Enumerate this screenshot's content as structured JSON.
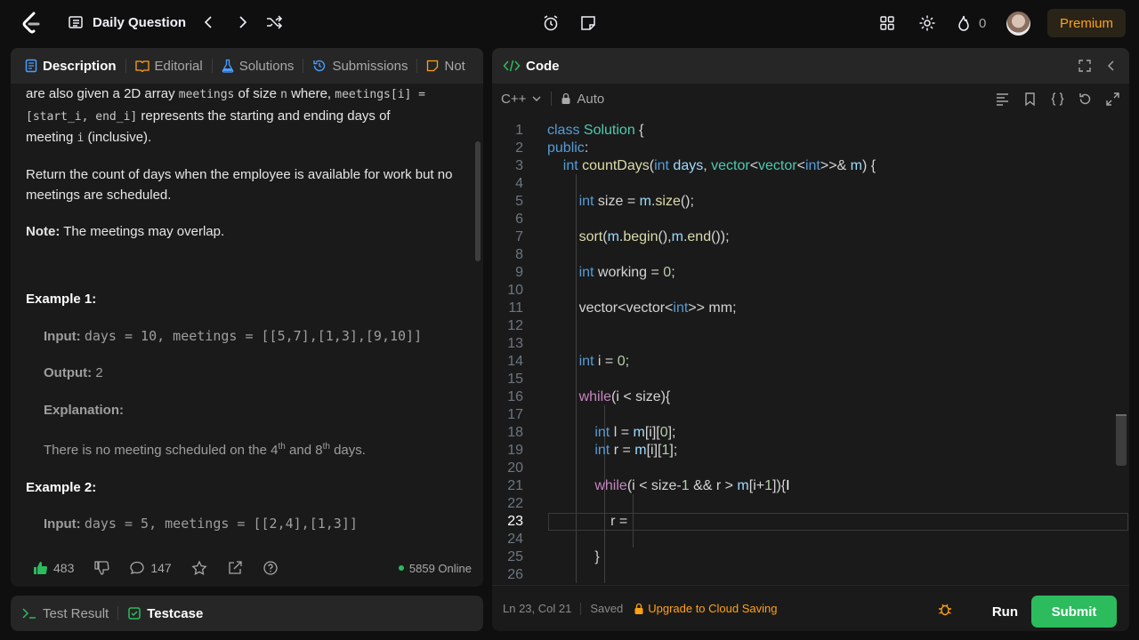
{
  "topbar": {
    "title": "Daily Question",
    "streak_count": "0",
    "premium_label": "Premium"
  },
  "left_panel": {
    "tabs": [
      {
        "label": "Description"
      },
      {
        "label": "Editorial"
      },
      {
        "label": "Solutions"
      },
      {
        "label": "Submissions"
      },
      {
        "label": "Not"
      }
    ],
    "desc": {
      "p1_a": "are also given a 2D array ",
      "p1_code1": "meetings",
      "p1_b": " of size ",
      "p1_code2": "n",
      "p1_c": " where, ",
      "p1_code3": "meetings[i] =",
      "p1_code4": "[start_i, end_i]",
      "p1_d": " represents the starting and ending days of",
      "p1_e": "meeting ",
      "p1_code5": "i",
      "p1_f": " (inclusive).",
      "p2": "Return the count of days when the employee is available for work but no meetings are scheduled.",
      "note_label": "Note:",
      "note_text": " The meetings may overlap.",
      "ex1_title": "Example 1:",
      "ex1_input_label": "Input:",
      "ex1_input": "days = 10, meetings = [[5,7],[1,3],[9,10]]",
      "ex1_output_label": "Output:",
      "ex1_output": "2",
      "ex1_expl_label": "Explanation:",
      "ex1_expl_a": "There is no meeting scheduled on the 4",
      "ex1_expl_sup1": "th",
      "ex1_expl_b": " and 8",
      "ex1_expl_sup2": "th",
      "ex1_expl_c": " days.",
      "ex2_title": "Example 2:",
      "ex2_input_label": "Input:",
      "ex2_input": "days = 5, meetings = [[2,4],[1,3]]"
    },
    "footer": {
      "likes": "483",
      "comments": "147",
      "online": "5859 Online"
    }
  },
  "bottom_panel": {
    "test_result": "Test Result",
    "testcase": "Testcase"
  },
  "code_panel": {
    "title": "Code",
    "language": "C++",
    "mode": "Auto",
    "lines": [
      {
        "n": "1"
      },
      {
        "n": "2"
      },
      {
        "n": "3"
      },
      {
        "n": "4"
      },
      {
        "n": "5"
      },
      {
        "n": "6"
      },
      {
        "n": "7"
      },
      {
        "n": "8"
      },
      {
        "n": "9"
      },
      {
        "n": "10"
      },
      {
        "n": "11"
      },
      {
        "n": "12"
      },
      {
        "n": "13"
      },
      {
        "n": "14"
      },
      {
        "n": "15"
      },
      {
        "n": "16"
      },
      {
        "n": "17"
      },
      {
        "n": "18"
      },
      {
        "n": "19"
      },
      {
        "n": "20"
      },
      {
        "n": "21"
      },
      {
        "n": "22"
      },
      {
        "n": "23"
      },
      {
        "n": "24"
      },
      {
        "n": "25"
      },
      {
        "n": "26"
      }
    ],
    "status": {
      "position": "Ln 23, Col 21",
      "saved": "Saved",
      "upgrade": "Upgrade to Cloud Saving",
      "run": "Run",
      "submit": "Submit"
    }
  },
  "colors": {
    "accent_green": "#2cbb5d",
    "premium_text": "#ffa116",
    "background": "#0f0f0f",
    "panel": "#1a1a1a"
  }
}
